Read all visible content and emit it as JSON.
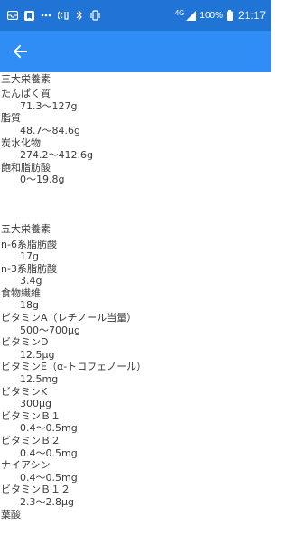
{
  "status_bar": {
    "time": "21:17",
    "battery_percent": "100%",
    "network_label": "4G",
    "left_icons": [
      "mail-icon",
      "shield-check-icon",
      "more-dots-icon",
      "nfc-icon",
      "bluetooth-icon",
      "vibrate-icon"
    ],
    "right_icons": [
      "network-4g-icon",
      "signal-icon",
      "battery-icon"
    ]
  },
  "app_bar": {
    "back_icon": "arrow-left-icon"
  },
  "colors": {
    "status_bar": "#1f74d6",
    "app_bar": "#2f8df5",
    "text": "#3a3a3a",
    "background": "#ffffff"
  },
  "sections": [
    {
      "title": "三大栄養素",
      "items": [
        {
          "name": "たんぱく質",
          "value": "71.3〜127g"
        },
        {
          "name": "脂質",
          "value": "48.7〜84.6g"
        },
        {
          "name": "炭水化物",
          "value": "274.2〜412.6g"
        },
        {
          "name": "飽和脂肪酸",
          "value": "0〜19.8g"
        }
      ]
    },
    {
      "title": "五大栄養素",
      "items": [
        {
          "name": "n-6系脂肪酸",
          "value": "17g"
        },
        {
          "name": "n-3系脂肪酸",
          "value": "3.4g"
        },
        {
          "name": "食物繊維",
          "value": "18g"
        },
        {
          "name": "ビタミンA（レチノール当量）",
          "value": "500〜700μg"
        },
        {
          "name": "ビタミンD",
          "value": "12.5μg"
        },
        {
          "name": "ビタミンE（α-トコフェノール）",
          "value": "12.5mg"
        },
        {
          "name": "ビタミンK",
          "value": "300μg"
        },
        {
          "name": "ビタミンＢ１",
          "value": "0.4〜0.5mg"
        },
        {
          "name": "ビタミンＢ２",
          "value": "0.4〜0.5mg"
        },
        {
          "name": "ナイアシン",
          "value": "0.4〜0.5mg"
        },
        {
          "name": "ビタミンＢ１２",
          "value": "2.3〜2.8μg"
        },
        {
          "name": "葉酸",
          "value": ""
        }
      ]
    }
  ]
}
